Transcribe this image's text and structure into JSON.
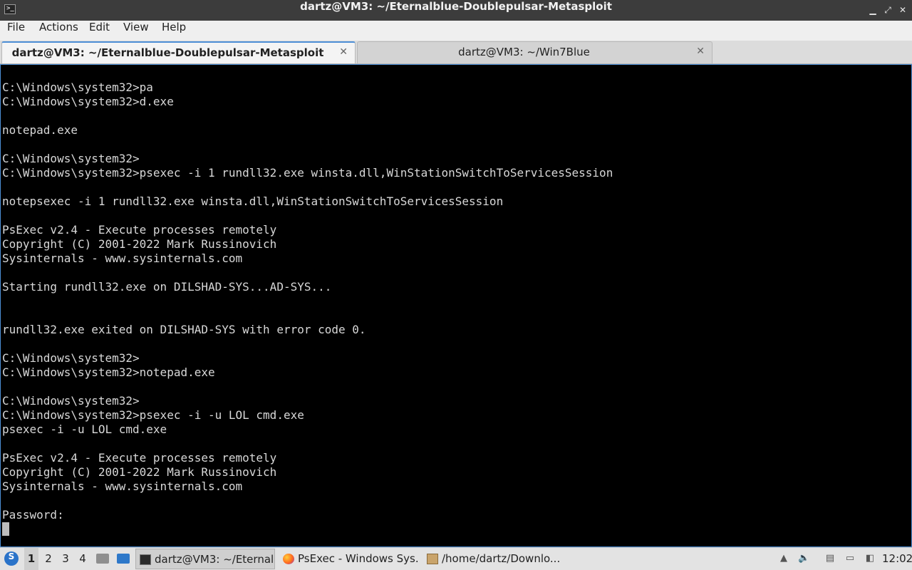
{
  "window": {
    "title": "dartz@VM3: ~/Eternalblue-Doublepulsar-Metasploit",
    "controls": {
      "minimize": "▁",
      "maximize": "⤢",
      "close": "✕"
    },
    "app_icon": ">_"
  },
  "menu": [
    "File",
    "Actions",
    "Edit",
    "View",
    "Help"
  ],
  "tabs": [
    {
      "label": "dartz@VM3: ~/Eternalblue-Doublepulsar-Metasploit",
      "active": true
    },
    {
      "label": "dartz@VM3: ~/Win7Blue",
      "active": false
    }
  ],
  "tab_close_glyph": "✕",
  "terminal": {
    "lines": [
      "C:\\Windows\\system32>pa",
      "C:\\Windows\\system32>d.exe",
      "",
      "notepad.exe",
      "",
      "C:\\Windows\\system32>",
      "C:\\Windows\\system32>psexec -i 1 rundll32.exe winsta.dll,WinStationSwitchToServicesSession",
      "",
      "notepsexec -i 1 rundll32.exe winsta.dll,WinStationSwitchToServicesSession",
      "",
      "PsExec v2.4 - Execute processes remotely",
      "Copyright (C) 2001-2022 Mark Russinovich",
      "Sysinternals - www.sysinternals.com",
      "",
      "Starting rundll32.exe on DILSHAD-SYS...AD-SYS...",
      "",
      "",
      "rundll32.exe exited on DILSHAD-SYS with error code 0.",
      "",
      "C:\\Windows\\system32>",
      "C:\\Windows\\system32>notepad.exe",
      "",
      "C:\\Windows\\system32>",
      "C:\\Windows\\system32>psexec -i -u LOL cmd.exe",
      "psexec -i -u LOL cmd.exe",
      "",
      "PsExec v2.4 - Execute processes remotely",
      "Copyright (C) 2001-2022 Mark Russinovich",
      "Sysinternals - www.sysinternals.com",
      "",
      "Password:"
    ]
  },
  "taskbar": {
    "workspaces": [
      "1",
      "2",
      "3",
      "4"
    ],
    "active_workspace": "1",
    "tasks": [
      {
        "label": "dartz@VM3: ~/Eternal...",
        "icon": "terminal-icon",
        "active": true
      },
      {
        "label": "PsExec - Windows Sys...",
        "icon": "firefox-icon",
        "active": false
      },
      {
        "label": "/home/dartz/Downlo...",
        "icon": "archive-icon",
        "active": false
      }
    ],
    "clock": "12:02"
  },
  "colors": {
    "accent": "#4d8fd6",
    "terminal_bg": "#000000",
    "terminal_fg": "#d8d8d8",
    "titlebar_bg": "#3c3c3c"
  }
}
